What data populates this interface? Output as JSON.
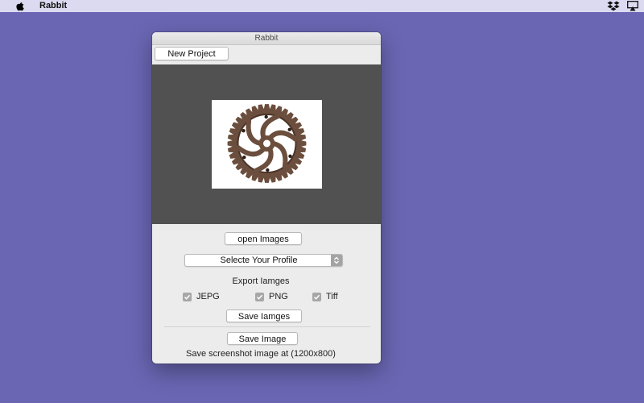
{
  "menubar": {
    "app_name": "Rabbit",
    "apple_icon": "apple-icon",
    "status_icons": [
      "dropbox-icon",
      "airplay-icon"
    ]
  },
  "window": {
    "title": "Rabbit",
    "new_project_label": "New Project",
    "preview_image": "gear-icon",
    "open_images_label": "open Images",
    "profile_select": {
      "selected": "Selecte Your Profile"
    },
    "export_label": "Export Iamges",
    "formats": [
      {
        "label": "JEPG",
        "checked": true
      },
      {
        "label": "PNG",
        "checked": true
      },
      {
        "label": "Tiff",
        "checked": true
      }
    ],
    "save_images_label": "Save Iamges",
    "save_image_label": "Save Image",
    "footer_text": "Save screenshot image at (1200x800)"
  },
  "colors": {
    "desktop": "#6a66b3",
    "menubar": "#dcdaf0",
    "preview_bg": "#515151",
    "gear": "#6b4e3d"
  }
}
